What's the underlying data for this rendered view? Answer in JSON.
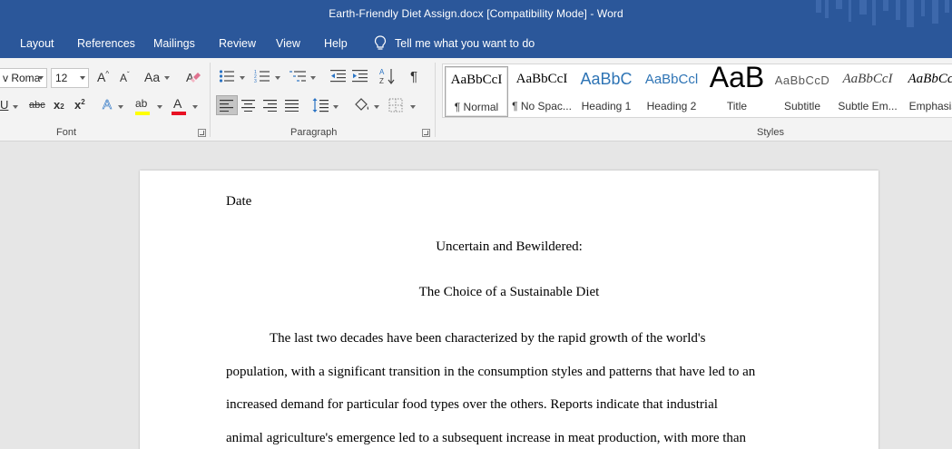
{
  "window": {
    "title": "Earth-Friendly Diet Assign.docx [Compatibility Mode]  -  Word"
  },
  "menu": {
    "tabs": [
      "Layout",
      "References",
      "Mailings",
      "Review",
      "View",
      "Help"
    ],
    "tell_me": "Tell me what you want to do"
  },
  "ribbon": {
    "font": {
      "label": "Font",
      "font_name": "v Roma",
      "font_size": "12",
      "grow_glyph": "A",
      "shrink_glyph": "A",
      "change_case": "Aa",
      "underline": "U",
      "strike": "abc",
      "subscript": "x",
      "sub_mark": "2",
      "superscript": "x",
      "sup_mark": "2",
      "text_effects": "A",
      "highlight": "ab",
      "font_color": "A",
      "highlight_color": "#ffff00",
      "font_color_bar": "#e81123"
    },
    "paragraph": {
      "label": "Paragraph"
    },
    "styles": {
      "label": "Styles",
      "items": [
        {
          "sample": "AaBbCcI",
          "name": "¶ Normal"
        },
        {
          "sample": "AaBbCcI",
          "name": "¶ No Spac..."
        },
        {
          "sample": "AaBbC",
          "name": "Heading 1"
        },
        {
          "sample": "AaBbCcl",
          "name": "Heading 2"
        },
        {
          "sample": "AaB",
          "name": "Title"
        },
        {
          "sample": "AaBbCcD",
          "name": "Subtitle"
        },
        {
          "sample": "AaBbCcI",
          "name": "Subtle Em..."
        },
        {
          "sample": "AaBbCcI",
          "name": "Emphasis"
        }
      ]
    }
  },
  "document": {
    "date": "Date",
    "title_line1": "Uncertain and Bewildered:",
    "title_line2": "The Choice of a Sustainable Diet",
    "lines": [
      "The last two decades have been characterized by the rapid growth of the world's",
      "population, with a significant transition in the consumption styles and patterns that have led to an",
      "increased demand for particular food types over the others. Reports indicate that industrial",
      "animal agriculture's emergence led to a subsequent increase in meat production, with more than"
    ]
  },
  "colors": {
    "accent": "#2b579a",
    "ribbon_bg": "#f3f3f3",
    "canvas_bg": "#e6e6e6"
  }
}
